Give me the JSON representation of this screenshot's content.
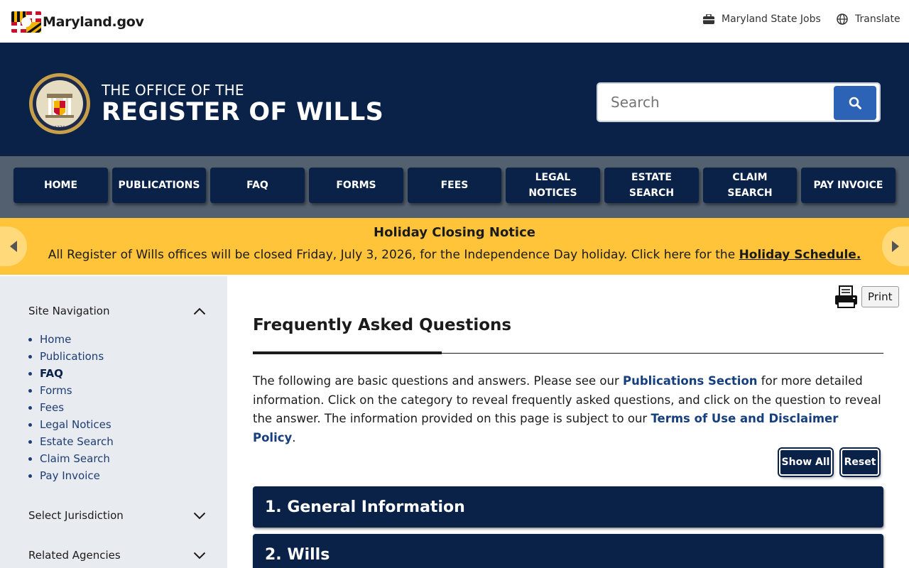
{
  "topbar": {
    "logo_text": "Maryland.gov",
    "jobs_label": "Maryland State Jobs",
    "translate_label": "Translate"
  },
  "header": {
    "office_small": "THE OFFICE OF THE",
    "office_big": "REGISTER OF WILLS",
    "search_placeholder": "Search",
    "search_value": ""
  },
  "nav": {
    "items": [
      {
        "label": "HOME"
      },
      {
        "label": "PUBLICATIONS"
      },
      {
        "label": "FAQ"
      },
      {
        "label": "FORMS"
      },
      {
        "label": "FEES"
      },
      {
        "label": "LEGAL\nNOTICES"
      },
      {
        "label": "ESTATE\nSEARCH"
      },
      {
        "label": "CLAIM\nSEARCH"
      },
      {
        "label": "PAY INVOICE"
      }
    ]
  },
  "alert": {
    "title": "Holiday Closing Notice",
    "body": "All Register of Wills offices will be closed Friday, July 3, 2026, for the Independence Day holiday. Click here for the ",
    "link": "Holiday Schedule."
  },
  "sidebar": {
    "site_nav_label": "Site Navigation",
    "items": [
      {
        "label": "Home",
        "active": false
      },
      {
        "label": "Publications",
        "active": false
      },
      {
        "label": "FAQ",
        "active": true
      },
      {
        "label": "Forms",
        "active": false
      },
      {
        "label": "Fees",
        "active": false
      },
      {
        "label": "Legal Notices",
        "active": false
      },
      {
        "label": "Estate Search",
        "active": false
      },
      {
        "label": "Claim Search",
        "active": false
      },
      {
        "label": "Pay Invoice",
        "active": false
      }
    ],
    "jurisdiction_label": "Select Jurisdiction",
    "agencies_label": "Related Agencies"
  },
  "main": {
    "print_label": "Print",
    "title": "Frequently Asked Questions",
    "intro_part1": "The following are basic questions and answers. Please see our ",
    "intro_link1": "Publications Section",
    "intro_part2": " for more detailed information. Click on the category to reveal frequently asked questions, and click on the question to reveal the answer. The information provided on this page is subject to our ",
    "intro_link2": "Terms of Use and Disclaimer Policy",
    "intro_part3": ".",
    "show_all_label": "Show All",
    "reset_label": "Reset",
    "accordions": [
      {
        "label": "1. General Information"
      },
      {
        "label": "2. Wills"
      }
    ]
  },
  "colors": {
    "navy": "#0a2248",
    "nav_bg": "#53606f",
    "alert_bg": "#ffc43a",
    "search_btn": "#2d63b6",
    "sidebar_bg": "#e8ebef",
    "link": "#163f7d"
  },
  "icons": {
    "jobs": "briefcase-icon",
    "translate": "globe-icon",
    "search": "search-icon",
    "print": "printer-icon",
    "alert_prev": "triangle-left-icon",
    "alert_next": "triangle-right-icon",
    "collapse": "chevron-up-icon",
    "expand": "chevron-down-icon"
  }
}
